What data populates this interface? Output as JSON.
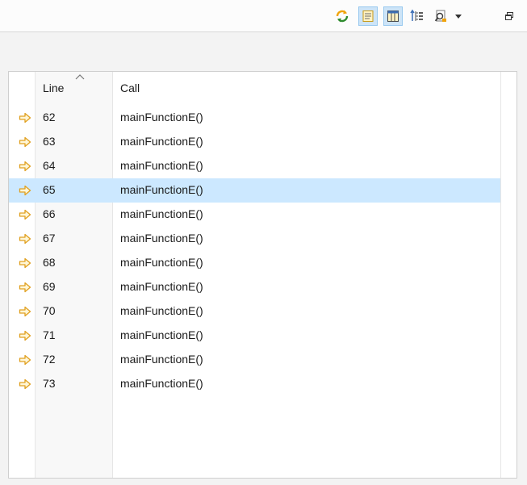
{
  "toolbar": {
    "icons": [
      "refresh-icon",
      "show-calls-icon",
      "show-columns-icon",
      "tree-view-icon",
      "find-icon",
      "menu-dropdown-icon",
      "restore-icon"
    ],
    "colors": {
      "accent_orange": "#f0a30a",
      "active_bg": "#cde4f7",
      "active_border": "#99c9ef"
    }
  },
  "table": {
    "headers": {
      "line": "Line",
      "call": "Call"
    },
    "sort": {
      "column": "line",
      "direction": "ascending"
    },
    "selected_color": "#cce8ff",
    "rows": [
      {
        "line": "62",
        "call": "mainFunctionE()",
        "selected": false
      },
      {
        "line": "63",
        "call": "mainFunctionE()",
        "selected": false
      },
      {
        "line": "64",
        "call": "mainFunctionE()",
        "selected": false
      },
      {
        "line": "65",
        "call": "mainFunctionE()",
        "selected": true
      },
      {
        "line": "66",
        "call": "mainFunctionE()",
        "selected": false
      },
      {
        "line": "67",
        "call": "mainFunctionE()",
        "selected": false
      },
      {
        "line": "68",
        "call": "mainFunctionE()",
        "selected": false
      },
      {
        "line": "69",
        "call": "mainFunctionE()",
        "selected": false
      },
      {
        "line": "70",
        "call": "mainFunctionE()",
        "selected": false
      },
      {
        "line": "71",
        "call": "mainFunctionE()",
        "selected": false
      },
      {
        "line": "72",
        "call": "mainFunctionE()",
        "selected": false
      },
      {
        "line": "73",
        "call": "mainFunctionE()",
        "selected": false
      }
    ]
  }
}
